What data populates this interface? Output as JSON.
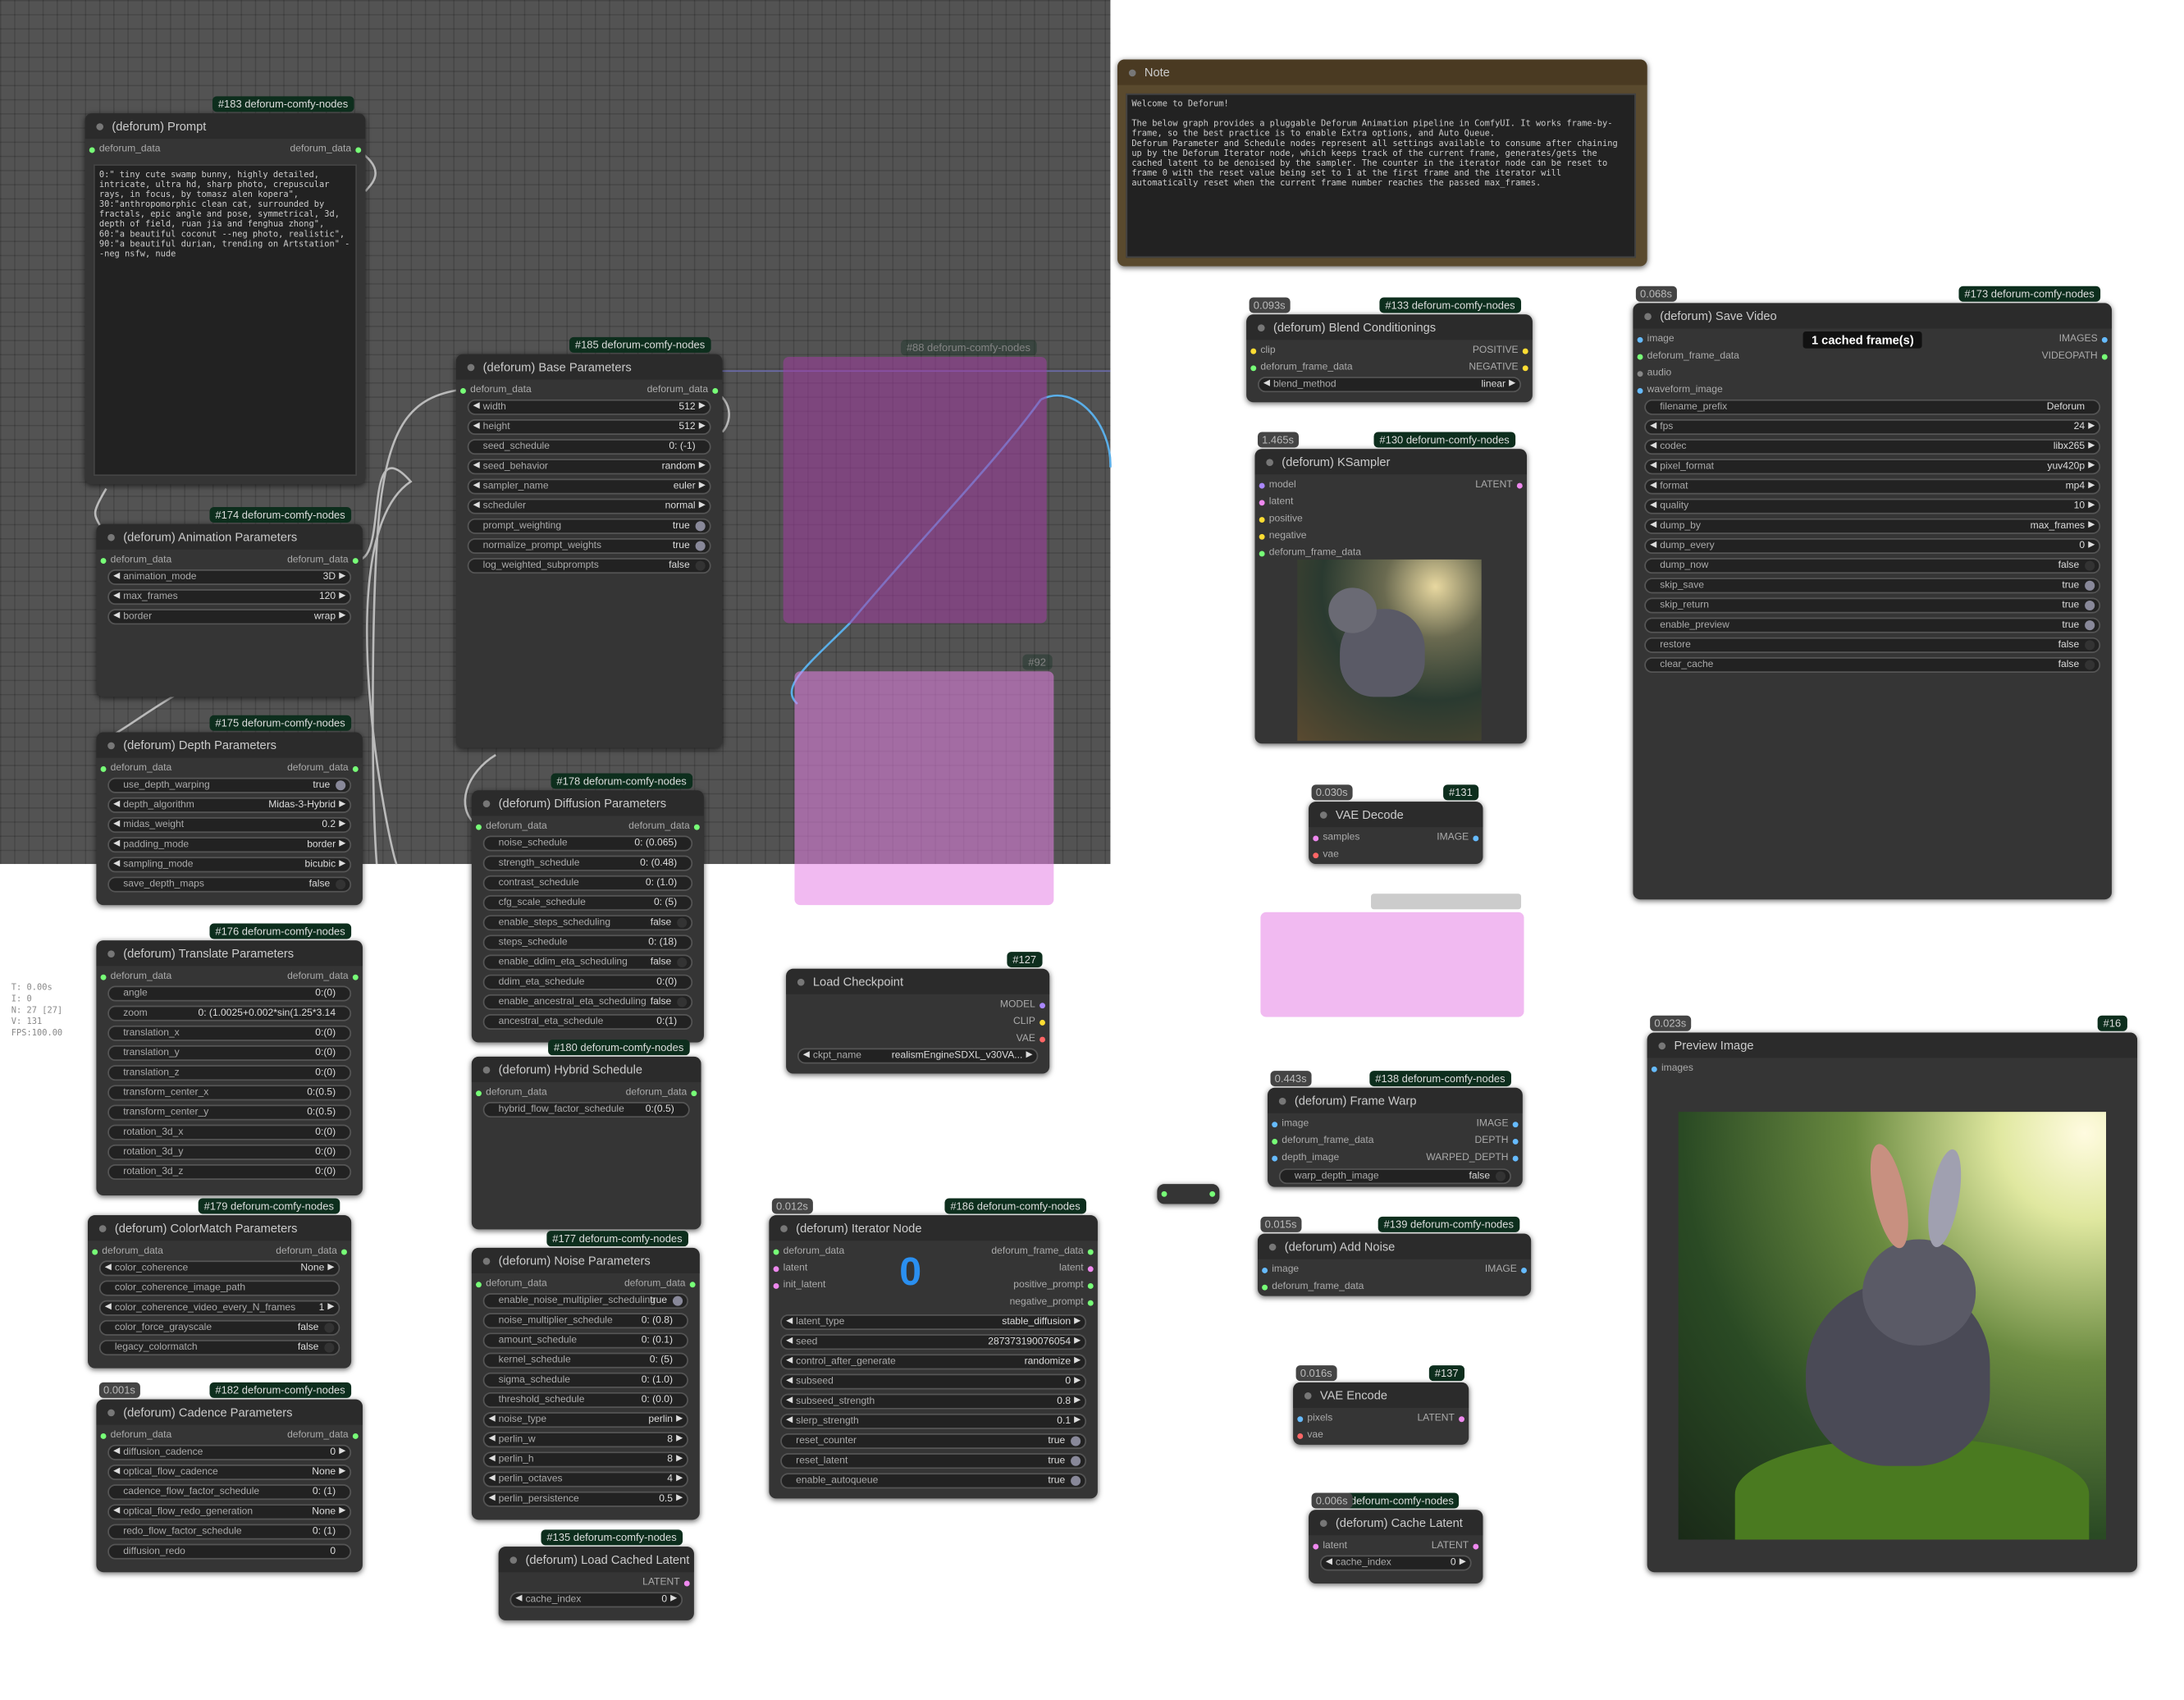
{
  "badges": {
    "prompt": "#183 deforum-comfy-nodes",
    "anim": "#174 deforum-comfy-nodes",
    "depth": "#175 deforum-comfy-nodes",
    "translate": "#176 deforum-comfy-nodes",
    "colormatch": "#179 deforum-comfy-nodes",
    "cadence": "#182 deforum-comfy-nodes",
    "base": "#185 deforum-comfy-nodes",
    "diffusion": "#178 deforum-comfy-nodes",
    "hybrid": "#180 deforum-comfy-nodes",
    "noise": "#177 deforum-comfy-nodes",
    "loadcached": "#135 deforum-comfy-nodes",
    "ghost_load": "#88 deforum-comfy-nodes",
    "ghost_preview": "#92",
    "checkpoint": "#127",
    "iterator": "#186 deforum-comfy-nodes",
    "blend": "#133 deforum-comfy-nodes",
    "ksampler": "#130 deforum-comfy-nodes",
    "vaedecode": "#131",
    "framewarp": "#138 deforum-comfy-nodes",
    "addnoise": "#139 deforum-comfy-nodes",
    "vaeencode": "#137",
    "cachelatent": "36 deforum-comfy-nodes",
    "savevideo": "#173 deforum-comfy-nodes",
    "previewimage": "#16"
  },
  "timings": {
    "cadence": "0.001s",
    "iterator": "0.012s",
    "blend": "0.093s",
    "ksampler": "1.465s",
    "vaedecode": "0.030s",
    "framewarp": "0.443s",
    "addnoise": "0.015s",
    "vaeencode": "0.016s",
    "cachelatent": "0.006s",
    "savevideo": "0.068s",
    "previewimage": "0.023s"
  },
  "titles": {
    "prompt": "(deforum) Prompt",
    "anim": "(deforum) Animation Parameters",
    "depth": "(deforum) Depth Parameters",
    "translate": "(deforum) Translate Parameters",
    "colormatch": "(deforum) ColorMatch Parameters",
    "cadence": "(deforum) Cadence Parameters",
    "base": "(deforum) Base Parameters",
    "diffusion": "(deforum) Diffusion Parameters",
    "hybrid": "(deforum) Hybrid Schedule",
    "noise": "(deforum) Noise Parameters",
    "loadcached": "(deforum) Load Cached Latent",
    "checkpoint": "Load Checkpoint",
    "iterator": "(deforum) Iterator Node",
    "note": "Note",
    "blend": "(deforum) Blend Conditionings",
    "ksampler": "(deforum) KSampler",
    "vaedecode": "VAE Decode",
    "framewarp": "(deforum) Frame Warp",
    "addnoise": "(deforum) Add Noise",
    "vaeencode": "VAE Encode",
    "cachelatent": "(deforum) Cache Latent",
    "savevideo": "(deforum) Save Video",
    "previewimage": "Preview Image"
  },
  "io": {
    "deforum_data": "deforum_data",
    "deforum_frame_data": "deforum_frame_data",
    "latent": "latent",
    "init_latent": "init_latent",
    "positive_prompt": "positive_prompt",
    "negative_prompt": "negative_prompt",
    "LATENT": "LATENT",
    "MODEL": "MODEL",
    "CLIP": "CLIP",
    "VAE": "VAE",
    "IMAGE": "IMAGE",
    "clip": "clip",
    "POSITIVE": "POSITIVE",
    "NEGATIVE": "NEGATIVE",
    "model": "model",
    "positive": "positive",
    "negative": "negative",
    "samples": "samples",
    "vae": "vae",
    "image": "image",
    "depth_image": "depth_image",
    "DEPTH": "DEPTH",
    "WARPED_DEPTH": "WARPED_DEPTH",
    "pixels": "pixels",
    "IMAGES": "IMAGES",
    "VIDEOPATH": "VIDEOPATH",
    "audio": "audio",
    "waveform_image": "waveform_image",
    "images": "images"
  },
  "prompt_text": "0:\" tiny cute swamp bunny, highly detailed, intricate, ultra hd, sharp photo, crepuscular rays, in focus, by tomasz alen kopera\", 30:\"anthropomorphic clean cat, surrounded by fractals, epic angle and pose, symmetrical, 3d, depth of field, ruan jia and fenghua zhong\", 60:\"a beautiful coconut --neg photo, realistic\", 90:\"a beautiful durian, trending on Artstation\" --neg nsfw, nude",
  "note_text": "Welcome to Deforum!\n\nThe below graph provides a pluggable Deforum Animation pipeline in ComfyUI. It works frame-by-frame, so the best practice is to enable Extra options, and Auto Queue.\nDeforum Parameter and Schedule nodes represent all settings available to consume after chaining up by the Deforum Iterator node, which keeps track of the current frame, generates/gets the cached latent to be denoised by the sampler. The counter in the iterator node can be reset to frame 0 with the reset value being set to 1 at the first frame and the iterator will automatically reset when the current frame number reaches the passed max_frames.",
  "anim": [
    {
      "k": "animation_mode",
      "v": "3D",
      "t": "combo"
    },
    {
      "k": "max_frames",
      "v": "120",
      "t": "combo"
    },
    {
      "k": "border",
      "v": "wrap",
      "t": "combo"
    }
  ],
  "depth": [
    {
      "k": "use_depth_warping",
      "v": "true",
      "t": "tog"
    },
    {
      "k": "depth_algorithm",
      "v": "Midas-3-Hybrid",
      "t": "combo"
    },
    {
      "k": "midas_weight",
      "v": "0.2",
      "t": "combo"
    },
    {
      "k": "padding_mode",
      "v": "border",
      "t": "combo"
    },
    {
      "k": "sampling_mode",
      "v": "bicubic",
      "t": "combo"
    },
    {
      "k": "save_depth_maps",
      "v": "false",
      "t": "togoff"
    }
  ],
  "translate": [
    {
      "k": "angle",
      "v": "0:(0)",
      "t": "txt"
    },
    {
      "k": "zoom",
      "v": "0: (1.0025+0.002*sin(1.25*3.14",
      "t": "txt"
    },
    {
      "k": "translation_x",
      "v": "0:(0)",
      "t": "txt"
    },
    {
      "k": "translation_y",
      "v": "0:(0)",
      "t": "txt"
    },
    {
      "k": "translation_z",
      "v": "0:(0)",
      "t": "txt"
    },
    {
      "k": "transform_center_x",
      "v": "0:(0.5)",
      "t": "txt"
    },
    {
      "k": "transform_center_y",
      "v": "0:(0.5)",
      "t": "txt"
    },
    {
      "k": "rotation_3d_x",
      "v": "0:(0)",
      "t": "txt"
    },
    {
      "k": "rotation_3d_y",
      "v": "0:(0)",
      "t": "txt"
    },
    {
      "k": "rotation_3d_z",
      "v": "0:(0)",
      "t": "txt"
    }
  ],
  "colormatch": [
    {
      "k": "color_coherence",
      "v": "None",
      "t": "combo"
    },
    {
      "k": "color_coherence_image_path",
      "v": "",
      "t": "txt"
    },
    {
      "k": "color_coherence_video_every_N_frames",
      "v": "1",
      "t": "combo"
    },
    {
      "k": "color_force_grayscale",
      "v": "false",
      "t": "togoff"
    },
    {
      "k": "legacy_colormatch",
      "v": "false",
      "t": "togoff"
    }
  ],
  "cadence": [
    {
      "k": "diffusion_cadence",
      "v": "0",
      "t": "combo"
    },
    {
      "k": "optical_flow_cadence",
      "v": "None",
      "t": "combo"
    },
    {
      "k": "cadence_flow_factor_schedule",
      "v": "0: (1)",
      "t": "txt"
    },
    {
      "k": "optical_flow_redo_generation",
      "v": "None",
      "t": "combo"
    },
    {
      "k": "redo_flow_factor_schedule",
      "v": "0: (1)",
      "t": "txt"
    },
    {
      "k": "diffusion_redo",
      "v": "0",
      "t": "txt"
    }
  ],
  "base": [
    {
      "k": "width",
      "v": "512",
      "t": "combo"
    },
    {
      "k": "height",
      "v": "512",
      "t": "combo"
    },
    {
      "k": "seed_schedule",
      "v": "0: (-1)",
      "t": "txt"
    },
    {
      "k": "seed_behavior",
      "v": "random",
      "t": "combo"
    },
    {
      "k": "sampler_name",
      "v": "euler",
      "t": "combo"
    },
    {
      "k": "scheduler",
      "v": "normal",
      "t": "combo"
    },
    {
      "k": "prompt_weighting",
      "v": "true",
      "t": "tog"
    },
    {
      "k": "normalize_prompt_weights",
      "v": "true",
      "t": "tog"
    },
    {
      "k": "log_weighted_subprompts",
      "v": "false",
      "t": "togoff"
    }
  ],
  "diffusion": [
    {
      "k": "noise_schedule",
      "v": "0: (0.065)",
      "t": "txt"
    },
    {
      "k": "strength_schedule",
      "v": "0: (0.48)",
      "t": "txt"
    },
    {
      "k": "contrast_schedule",
      "v": "0: (1.0)",
      "t": "txt"
    },
    {
      "k": "cfg_scale_schedule",
      "v": "0: (5)",
      "t": "txt"
    },
    {
      "k": "enable_steps_scheduling",
      "v": "false",
      "t": "togoff"
    },
    {
      "k": "steps_schedule",
      "v": "0: (18)",
      "t": "txt"
    },
    {
      "k": "enable_ddim_eta_scheduling",
      "v": "false",
      "t": "togoff"
    },
    {
      "k": "ddim_eta_schedule",
      "v": "0:(0)",
      "t": "txt"
    },
    {
      "k": "enable_ancestral_eta_scheduling",
      "v": "false",
      "t": "togoff"
    },
    {
      "k": "ancestral_eta_schedule",
      "v": "0:(1)",
      "t": "txt"
    }
  ],
  "hybrid": [
    {
      "k": "hybrid_flow_factor_schedule",
      "v": "0:(0.5)",
      "t": "txt"
    }
  ],
  "noise": [
    {
      "k": "enable_noise_multiplier_scheduling",
      "v": "true",
      "t": "tog"
    },
    {
      "k": "noise_multiplier_schedule",
      "v": "0: (0.8)",
      "t": "txt"
    },
    {
      "k": "amount_schedule",
      "v": "0: (0.1)",
      "t": "txt"
    },
    {
      "k": "kernel_schedule",
      "v": "0: (5)",
      "t": "txt"
    },
    {
      "k": "sigma_schedule",
      "v": "0: (1.0)",
      "t": "txt"
    },
    {
      "k": "threshold_schedule",
      "v": "0: (0.0)",
      "t": "txt"
    },
    {
      "k": "noise_type",
      "v": "perlin",
      "t": "combo"
    },
    {
      "k": "perlin_w",
      "v": "8",
      "t": "combo"
    },
    {
      "k": "perlin_h",
      "v": "8",
      "t": "combo"
    },
    {
      "k": "perlin_octaves",
      "v": "4",
      "t": "combo"
    },
    {
      "k": "perlin_persistence",
      "v": "0.5",
      "t": "combo"
    }
  ],
  "loadcached": [
    {
      "k": "cache_index",
      "v": "0",
      "t": "combo"
    }
  ],
  "checkpoint": [
    {
      "k": "ckpt_name",
      "v": "realismEngineSDXL_v30VA...",
      "t": "combo"
    }
  ],
  "iterator_counter": "0",
  "iterator": [
    {
      "k": "latent_type",
      "v": "stable_diffusion",
      "t": "combo"
    },
    {
      "k": "seed",
      "v": "287373190076054",
      "t": "combo"
    },
    {
      "k": "control_after_generate",
      "v": "randomize",
      "t": "combo"
    },
    {
      "k": "subseed",
      "v": "0",
      "t": "combo"
    },
    {
      "k": "subseed_strength",
      "v": "0.8",
      "t": "combo"
    },
    {
      "k": "slerp_strength",
      "v": "0.1",
      "t": "combo"
    },
    {
      "k": "reset_counter",
      "v": "true",
      "t": "tog"
    },
    {
      "k": "reset_latent",
      "v": "true",
      "t": "tog"
    },
    {
      "k": "enable_autoqueue",
      "v": "true",
      "t": "tog"
    }
  ],
  "blend": [
    {
      "k": "blend_method",
      "v": "linear",
      "t": "combo"
    }
  ],
  "framewarp": [
    {
      "k": "warp_depth_image",
      "v": "false",
      "t": "togoff"
    }
  ],
  "cachelatent": [
    {
      "k": "cache_index",
      "v": "0",
      "t": "combo"
    }
  ],
  "savevideo_cached": "1 cached frame(s)",
  "savevideo": [
    {
      "k": "filename_prefix",
      "v": "Deforum",
      "t": "txt"
    },
    {
      "k": "fps",
      "v": "24",
      "t": "combo"
    },
    {
      "k": "codec",
      "v": "libx265",
      "t": "combo"
    },
    {
      "k": "pixel_format",
      "v": "yuv420p",
      "t": "combo"
    },
    {
      "k": "format",
      "v": "mp4",
      "t": "combo"
    },
    {
      "k": "quality",
      "v": "10",
      "t": "combo"
    },
    {
      "k": "dump_by",
      "v": "max_frames",
      "t": "combo"
    },
    {
      "k": "dump_every",
      "v": "0",
      "t": "combo"
    },
    {
      "k": "dump_now",
      "v": "false",
      "t": "togoff"
    },
    {
      "k": "skip_save",
      "v": "true",
      "t": "tog"
    },
    {
      "k": "skip_return",
      "v": "true",
      "t": "tog"
    },
    {
      "k": "enable_preview",
      "v": "true",
      "t": "tog"
    },
    {
      "k": "restore",
      "v": "false",
      "t": "togoff"
    },
    {
      "k": "clear_cache",
      "v": "false",
      "t": "togoff"
    }
  ],
  "stats": [
    "T: 0.00s",
    "I: 0",
    "N: 27 [27]",
    "V: 131",
    "FPS:100.00"
  ],
  "colors": {
    "slot_data": "#7f7",
    "slot_latent": "#e8e",
    "slot_model": "#a8f",
    "slot_clip": "#fd3",
    "slot_vae": "#f66",
    "slot_image": "#6bf",
    "wire_blue": "#5aaee8",
    "wire_grey": "#bbb"
  }
}
